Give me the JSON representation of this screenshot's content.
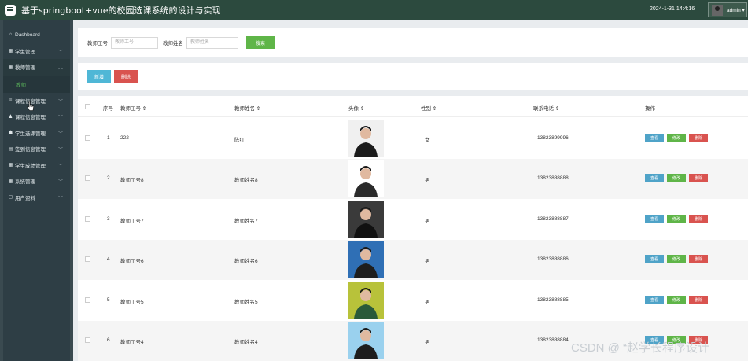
{
  "header": {
    "title": "基于springboot+vue的校园选课系统的设计与实现",
    "datetime": "2024-1-31 14:4:16",
    "user": "admin ▾"
  },
  "sidebar": {
    "items": [
      {
        "icon": "⌂",
        "label": "Dashboard",
        "chevron": ""
      },
      {
        "icon": "▦",
        "label": "学生管理",
        "chevron": "﹀"
      },
      {
        "icon": "▦",
        "label": "教师管理",
        "chevron": "︿"
      },
      {
        "icon": "≡",
        "label": "课程信息管理",
        "chevron": "﹀"
      },
      {
        "icon": "♟",
        "label": "课程信息管理",
        "chevron": "﹀"
      },
      {
        "icon": "☗",
        "label": "学生选课管理",
        "chevron": "﹀"
      },
      {
        "icon": "▤",
        "label": "签到信息管理",
        "chevron": "﹀"
      },
      {
        "icon": "▦",
        "label": "学生成绩管理",
        "chevron": "﹀"
      },
      {
        "icon": "▦",
        "label": "系统管理",
        "chevron": "﹀"
      },
      {
        "icon": "▢",
        "label": "用户资料",
        "chevron": "﹀"
      }
    ],
    "active_sub": "教师"
  },
  "search": {
    "teacher_no_label": "教师工号",
    "teacher_no_placeholder": "教师工号",
    "teacher_name_label": "教师姓名",
    "teacher_name_placeholder": "教师姓名",
    "search_button": "搜索"
  },
  "actions": {
    "add": "新增",
    "delete": "删除"
  },
  "table": {
    "columns": [
      "序号",
      "教师工号 ⇕",
      "教师姓名 ⇕",
      "头像 ⇕",
      "性别 ⇕",
      "联系电话 ⇕",
      "操作"
    ],
    "rows": [
      {
        "index": "1",
        "no": "222",
        "name": "陈红",
        "gender": "女",
        "phone": "13823899996"
      },
      {
        "index": "2",
        "no": "教师工号8",
        "name": "教师姓名8",
        "gender": "男",
        "phone": "13823888888"
      },
      {
        "index": "3",
        "no": "教师工号7",
        "name": "教师姓名7",
        "gender": "男",
        "phone": "13823888887"
      },
      {
        "index": "4",
        "no": "教师工号6",
        "name": "教师姓名6",
        "gender": "男",
        "phone": "13823888886"
      },
      {
        "index": "5",
        "no": "教师工号5",
        "name": "教师姓名5",
        "gender": "男",
        "phone": "13823888885"
      },
      {
        "index": "6",
        "no": "教师工号4",
        "name": "教师姓名4",
        "gender": "男",
        "phone": "13823888884"
      }
    ],
    "ops": {
      "view": "查看",
      "edit": "修改",
      "delete": "删除"
    }
  },
  "watermark": "CSDN @ “赵学长程序设计",
  "colors": {
    "topbar": "#2c4a3e",
    "sidebar": "#2e3e45",
    "accent_green": "#5fb548",
    "accent_blue": "#4fb7d6",
    "danger": "#d9534f"
  }
}
